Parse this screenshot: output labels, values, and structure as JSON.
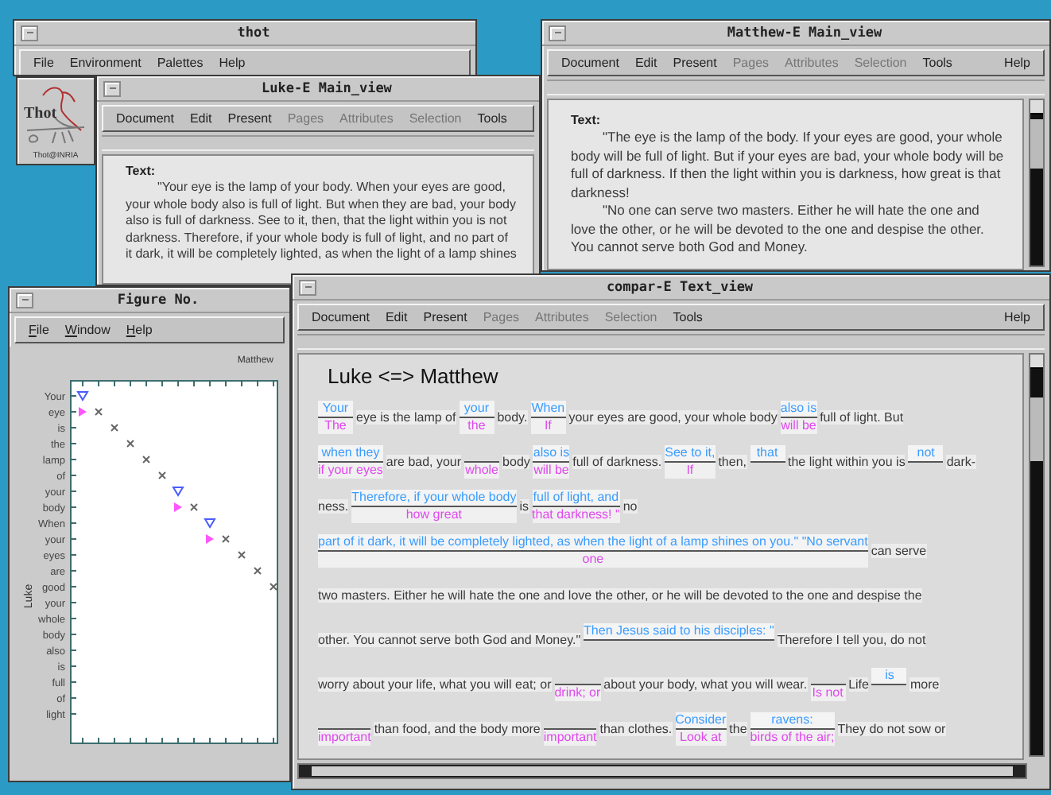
{
  "thot_window": {
    "title": "thot",
    "menu": [
      "File",
      "Environment",
      "Palettes",
      "Help"
    ]
  },
  "logo_panel": {
    "logo_text": "Thot",
    "caption": "Thot@INRIA"
  },
  "luke_window": {
    "title": "Luke-E Main_view",
    "menu": [
      {
        "label": "Document",
        "disabled": false
      },
      {
        "label": "Edit",
        "disabled": false
      },
      {
        "label": "Present",
        "disabled": false
      },
      {
        "label": "Pages",
        "disabled": true
      },
      {
        "label": "Attributes",
        "disabled": true
      },
      {
        "label": "Selection",
        "disabled": true
      },
      {
        "label": "Tools",
        "disabled": false
      }
    ],
    "label": "Text:",
    "paragraphs": [
      "\"Your eye is the lamp of your body. When your eyes are good, your whole body also is full of light. But when they are bad, your body also is full of darkness. See to it, then, that the light within you is not darkness. Therefore, if your whole body is full of light, and no part of it dark, it will be completely lighted, as when the light of a lamp shines"
    ]
  },
  "matthew_window": {
    "title": "Matthew-E Main_view",
    "menu": [
      {
        "label": "Document",
        "disabled": false
      },
      {
        "label": "Edit",
        "disabled": false
      },
      {
        "label": "Present",
        "disabled": false
      },
      {
        "label": "Pages",
        "disabled": true
      },
      {
        "label": "Attributes",
        "disabled": true
      },
      {
        "label": "Selection",
        "disabled": true
      },
      {
        "label": "Tools",
        "disabled": false
      }
    ],
    "help": "Help",
    "label": "Text:",
    "paragraphs": [
      "\"The eye is the lamp of the body. If your eyes are good, your whole body will be full of light. But if your eyes are bad, your whole body will be full of darkness. If then the light within you is darkness, how great is that darkness!",
      "\"No one can serve two masters. Either he will hate the one and love the other, or he will be devoted to the one and despise the other. You cannot serve both God and Money."
    ]
  },
  "figure_window": {
    "title": "Figure No.",
    "menu": [
      "File",
      "Window",
      "Help"
    ],
    "x_label": "Matthew",
    "y_label": "Luke",
    "y_categories": [
      "Your",
      "eye",
      "is",
      "the",
      "lamp",
      "of",
      "your",
      "body",
      "When",
      "your",
      "eyes",
      "are",
      "good",
      "your",
      "whole",
      "body",
      "also",
      "is",
      "full",
      "of",
      "light"
    ]
  },
  "compare_window": {
    "title": "compar-E Text_view",
    "menu": [
      {
        "label": "Document",
        "disabled": false
      },
      {
        "label": "Edit",
        "disabled": false
      },
      {
        "label": "Present",
        "disabled": false
      },
      {
        "label": "Pages",
        "disabled": true
      },
      {
        "label": "Attributes",
        "disabled": true
      },
      {
        "label": "Selection",
        "disabled": true
      },
      {
        "label": "Tools",
        "disabled": false
      }
    ],
    "help": "Help",
    "heading": "Luke <=> Matthew",
    "lines": [
      {
        "segments": [
          {
            "kind": "variant",
            "luke": "Your",
            "matthew": "The"
          },
          {
            "kind": "text",
            "text": "eye is the lamp of"
          },
          {
            "kind": "variant",
            "luke": "your",
            "matthew": "the"
          },
          {
            "kind": "text",
            "text": "body."
          },
          {
            "kind": "variant",
            "luke": "When",
            "matthew": "If"
          },
          {
            "kind": "text",
            "text": "your eyes are good, your whole body"
          },
          {
            "kind": "variant",
            "luke": "also is",
            "matthew": "will be"
          },
          {
            "kind": "text",
            "text": "full of light. But"
          }
        ]
      },
      {
        "segments": [
          {
            "kind": "variant",
            "luke": "when they",
            "matthew": "if your eyes"
          },
          {
            "kind": "text",
            "text": "are bad, your"
          },
          {
            "kind": "variant",
            "matthew": "whole"
          },
          {
            "kind": "text",
            "text": "body"
          },
          {
            "kind": "variant",
            "luke": "also is",
            "matthew": "will be"
          },
          {
            "kind": "text",
            "text": "full of darkness."
          },
          {
            "kind": "variant",
            "luke": "See to it,",
            "matthew": "If"
          },
          {
            "kind": "text",
            "text": "then,"
          },
          {
            "kind": "variant",
            "luke": "that"
          },
          {
            "kind": "text",
            "text": "the light within you is"
          },
          {
            "kind": "variant",
            "luke": "not"
          },
          {
            "kind": "text",
            "text": "dark-"
          }
        ]
      },
      {
        "segments": [
          {
            "kind": "text",
            "text": "ness."
          },
          {
            "kind": "variant",
            "luke": "Therefore, if your whole body",
            "matthew": "how great"
          },
          {
            "kind": "text",
            "text": "is"
          },
          {
            "kind": "variant",
            "luke": "full of light, and",
            "matthew": "that darkness! \""
          },
          {
            "kind": "text",
            "text": "no"
          }
        ]
      },
      {
        "segments": [
          {
            "kind": "variant",
            "luke": "part of it dark, it will be completely lighted, as when the light of a lamp shines on you.\" \"No servant",
            "matthew": "one"
          },
          {
            "kind": "text",
            "text": "can serve"
          }
        ]
      },
      {
        "segments": [
          {
            "kind": "text",
            "text": "two masters. Either he will hate the one and love the other, or he will be devoted to the one and despise the"
          }
        ]
      },
      {
        "segments": [
          {
            "kind": "text",
            "text": "other. You cannot serve both God and Money.\""
          },
          {
            "kind": "variant",
            "luke": "Then Jesus said to his disciples: \""
          },
          {
            "kind": "text",
            "text": "Therefore I tell you, do not"
          }
        ]
      },
      {
        "segments": [
          {
            "kind": "text",
            "text": "worry about your life, what you will eat; or"
          },
          {
            "kind": "variant",
            "matthew": "drink; or"
          },
          {
            "kind": "text",
            "text": "about your body, what you will wear."
          },
          {
            "kind": "variant",
            "matthew": "Is not"
          },
          {
            "kind": "text",
            "text": "Life"
          },
          {
            "kind": "variant",
            "luke": "is"
          },
          {
            "kind": "text",
            "text": "more"
          }
        ]
      },
      {
        "segments": [
          {
            "kind": "variant",
            "matthew": "important"
          },
          {
            "kind": "text",
            "text": "than food, and the body more"
          },
          {
            "kind": "variant",
            "matthew": "important"
          },
          {
            "kind": "text",
            "text": "than clothes."
          },
          {
            "kind": "variant",
            "luke": "Consider",
            "matthew": "Look at"
          },
          {
            "kind": "text",
            "text": "the"
          },
          {
            "kind": "variant",
            "luke": "ravens:",
            "matthew": "birds of the air;"
          },
          {
            "kind": "text",
            "text": "They do not sow or"
          }
        ]
      }
    ]
  }
}
